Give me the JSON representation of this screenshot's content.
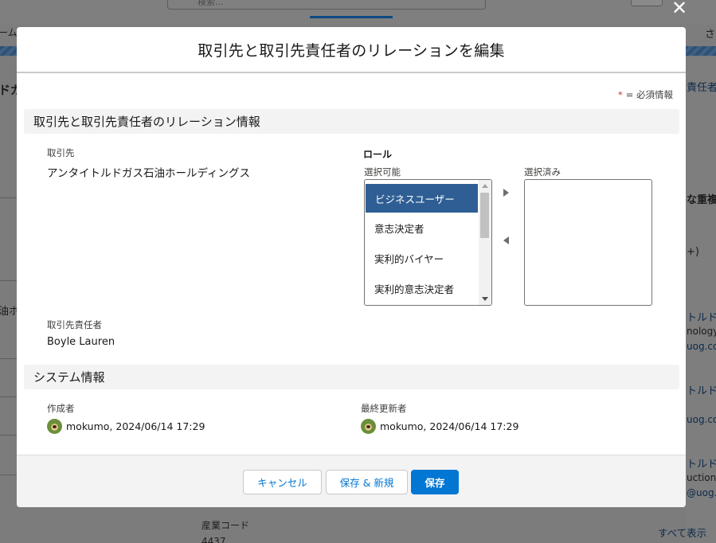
{
  "modal": {
    "title": "取引先と取引先責任者のリレーションを編集",
    "required_legend": "= 必須情報",
    "required_mark": "*"
  },
  "relation_section": {
    "title": "取引先と取引先責任者のリレーション情報",
    "account_label": "取引先",
    "account_value": "アンタイトルドガス石油ホールディングス",
    "contact_label": "取引先責任者",
    "contact_value": "Boyle Lauren"
  },
  "role": {
    "title": "ロール",
    "available_label": "選択可能",
    "selected_label": "選択済み",
    "available_options": [
      "ビジネスユーザー",
      "意志決定者",
      "実利的バイヤー",
      "実利的意志決定者"
    ],
    "selected_option": "ビジネスユーザー",
    "selected_options": []
  },
  "system_section": {
    "title": "システム情報",
    "created_by_label": "作成者",
    "created_by_value": "mokumo, 2024/06/14 17:29",
    "modified_by_label": "最終更新者",
    "modified_by_value": "mokumo, 2024/06/14 17:29"
  },
  "footer": {
    "cancel_label": "キャンセル",
    "save_new_label": "保存 & 新規",
    "save_label": "保存"
  },
  "background": {
    "search_placeholder": "検索...",
    "left_tab_fragment": "ーム",
    "left_heading_fragment": "ドガ",
    "left_oil_fragment": "油ホ",
    "right_tab_fragment": "さ",
    "right_contact_link": "責任者",
    "right_duplicate_heading": "な重複",
    "right_count": "+)",
    "right_link_1": "トルドガ",
    "right_text_1": "nology",
    "right_email_1": "uog.com",
    "right_link_2": "トルドガ",
    "right_email_2": "uog.co",
    "right_link_3": "トルドガ",
    "right_text_3": "uction",
    "right_email_3": "@uog.co",
    "industry_code_label": "産業コード",
    "industry_code_value": "4437",
    "view_all_link": "すべて表示"
  }
}
